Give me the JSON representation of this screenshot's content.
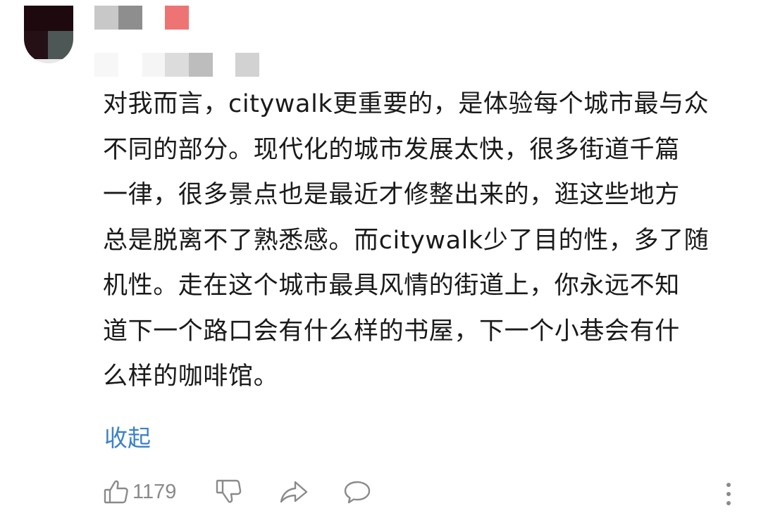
{
  "comment": {
    "body": "对我而言，citywalk更重要的，是体验每个城市最与众\n不同的部分。现代化的城市发展太快，很多街道千篇\n一律，很多景点也是最近才修整出来的，逛这些地方\n总是脱离不了熟悉感。而citywalk少了目的性，多了随\n机性。走在这个城市最具风情的街道上，你永远不知\n道下一个路口会有什么样的书屋，下一个小巷会有什\n么样的咖啡馆。",
    "collapse_label": "收起"
  },
  "actions": {
    "like_count": "1179",
    "like_icon": "thumbs-up-icon",
    "dislike_icon": "thumbs-down-icon",
    "share_icon": "share-arrow-icon",
    "reply_icon": "chat-bubble-icon",
    "more_icon": "vertical-ellipsis-icon"
  },
  "colors": {
    "link": "#3c82c8",
    "text": "#1a1a1a",
    "muted": "#8a8a8a"
  }
}
